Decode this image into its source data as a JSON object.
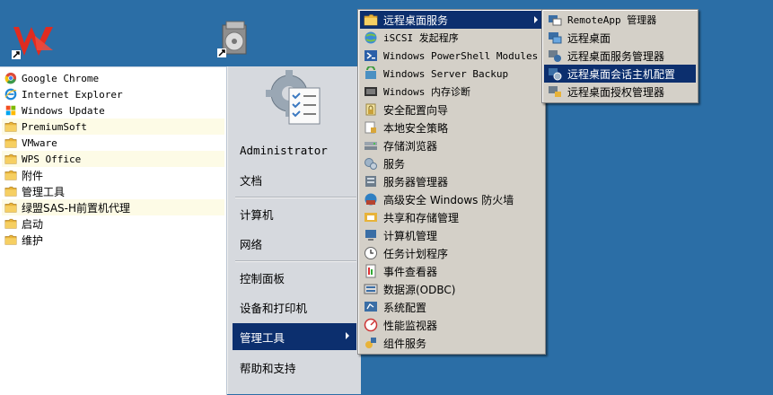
{
  "programs": [
    {
      "label": "Google Chrome",
      "icon": "chrome-icon",
      "mono": true,
      "highlight": false
    },
    {
      "label": "Internet Explorer",
      "icon": "ie-icon",
      "mono": true,
      "highlight": false
    },
    {
      "label": "Windows Update",
      "icon": "windows-update-icon",
      "mono": true,
      "highlight": false
    },
    {
      "label": "PremiumSoft",
      "icon": "folder-icon",
      "mono": true,
      "highlight": true
    },
    {
      "label": "VMware",
      "icon": "folder-icon",
      "mono": true,
      "highlight": false
    },
    {
      "label": "WPS Office",
      "icon": "folder-icon",
      "mono": true,
      "highlight": true
    },
    {
      "label": "附件",
      "icon": "folder-icon",
      "mono": false,
      "highlight": false
    },
    {
      "label": "管理工具",
      "icon": "folder-icon",
      "mono": false,
      "highlight": false
    },
    {
      "label": "绿盟SAS-H前置机代理",
      "icon": "folder-icon",
      "mono": false,
      "highlight": true
    },
    {
      "label": "启动",
      "icon": "folder-icon",
      "mono": false,
      "highlight": false
    },
    {
      "label": "维护",
      "icon": "folder-icon",
      "mono": false,
      "highlight": false
    }
  ],
  "start_right": {
    "user": "Administrator",
    "items": [
      {
        "label": "文档"
      },
      {
        "label": "计算机"
      },
      {
        "label": "网络"
      },
      {
        "label": "控制面板"
      },
      {
        "label": "设备和打印机"
      },
      {
        "label": "管理工具"
      },
      {
        "label": "帮助和支持"
      }
    ]
  },
  "admin_menu": [
    {
      "label": "远程桌面服务",
      "icon": "folder-icon",
      "mono": false,
      "selected": true
    },
    {
      "label": "iSCSI 发起程序",
      "icon": "iscsi-icon",
      "mono": true
    },
    {
      "label": "Windows PowerShell Modules",
      "icon": "powershell-icon",
      "mono": true
    },
    {
      "label": "Windows Server Backup",
      "icon": "backup-icon",
      "mono": true
    },
    {
      "label": "Windows 内存诊断",
      "icon": "memory-diagnostic-icon",
      "mono": true
    },
    {
      "label": "安全配置向导",
      "icon": "security-wizard-icon",
      "mono": false
    },
    {
      "label": "本地安全策略",
      "icon": "local-policy-icon",
      "mono": false
    },
    {
      "label": "存储浏览器",
      "icon": "storage-explorer-icon",
      "mono": false
    },
    {
      "label": "服务",
      "icon": "services-icon",
      "mono": false
    },
    {
      "label": "服务器管理器",
      "icon": "server-manager-icon",
      "mono": false
    },
    {
      "label": "高级安全 Windows 防火墙",
      "icon": "firewall-icon",
      "mono": false
    },
    {
      "label": "共享和存储管理",
      "icon": "share-storage-icon",
      "mono": false
    },
    {
      "label": "计算机管理",
      "icon": "computer-management-icon",
      "mono": false
    },
    {
      "label": "任务计划程序",
      "icon": "task-scheduler-icon",
      "mono": false
    },
    {
      "label": "事件查看器",
      "icon": "event-viewer-icon",
      "mono": false
    },
    {
      "label": "数据源(ODBC)",
      "icon": "odbc-icon",
      "mono": false
    },
    {
      "label": "系统配置",
      "icon": "system-config-icon",
      "mono": false
    },
    {
      "label": "性能监视器",
      "icon": "performance-monitor-icon",
      "mono": false
    },
    {
      "label": "组件服务",
      "icon": "component-services-icon",
      "mono": false
    }
  ],
  "rds_menu": [
    {
      "label": "RemoteApp 管理器",
      "icon": "remoteapp-icon",
      "mono": true
    },
    {
      "label": "远程桌面",
      "icon": "remote-desktop-icon",
      "mono": false
    },
    {
      "label": "远程桌面服务管理器",
      "icon": "rds-manager-icon",
      "mono": false
    },
    {
      "label": "远程桌面会话主机配置",
      "icon": "session-host-config-icon",
      "mono": false,
      "selected": true
    },
    {
      "label": "远程桌面授权管理器",
      "icon": "licensing-manager-icon",
      "mono": false
    }
  ],
  "colors": {
    "desktop": "#2b6ea6",
    "selection": "#0c2f6e",
    "menu": "#d4d0c8",
    "folder": "#e8b339",
    "wps_red": "#d9281f"
  }
}
